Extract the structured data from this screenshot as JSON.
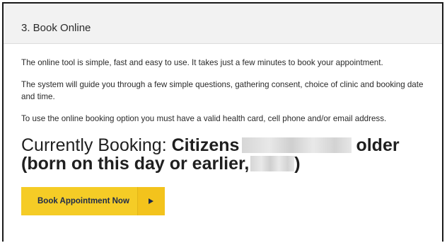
{
  "section": {
    "title": "3. Book Online"
  },
  "paragraphs": [
    "The online tool is simple, fast and easy to use. It takes just a few minutes to book your appointment.",
    "The system will guide you through a few simple questions, gathering consent, choice of clinic and booking date and time.",
    "To use the online booking option you must have a valid health card, cell phone and/or email address."
  ],
  "booking": {
    "prefix": "Currently Booking: ",
    "eligibility_start": "Citizens",
    "eligibility_end": "older",
    "born_prefix": "(born on this day or earlier,",
    "born_suffix": ")"
  },
  "cta": {
    "label": "Book Appointment Now",
    "icon": "play-arrow-icon",
    "color": "#f5cc26"
  }
}
